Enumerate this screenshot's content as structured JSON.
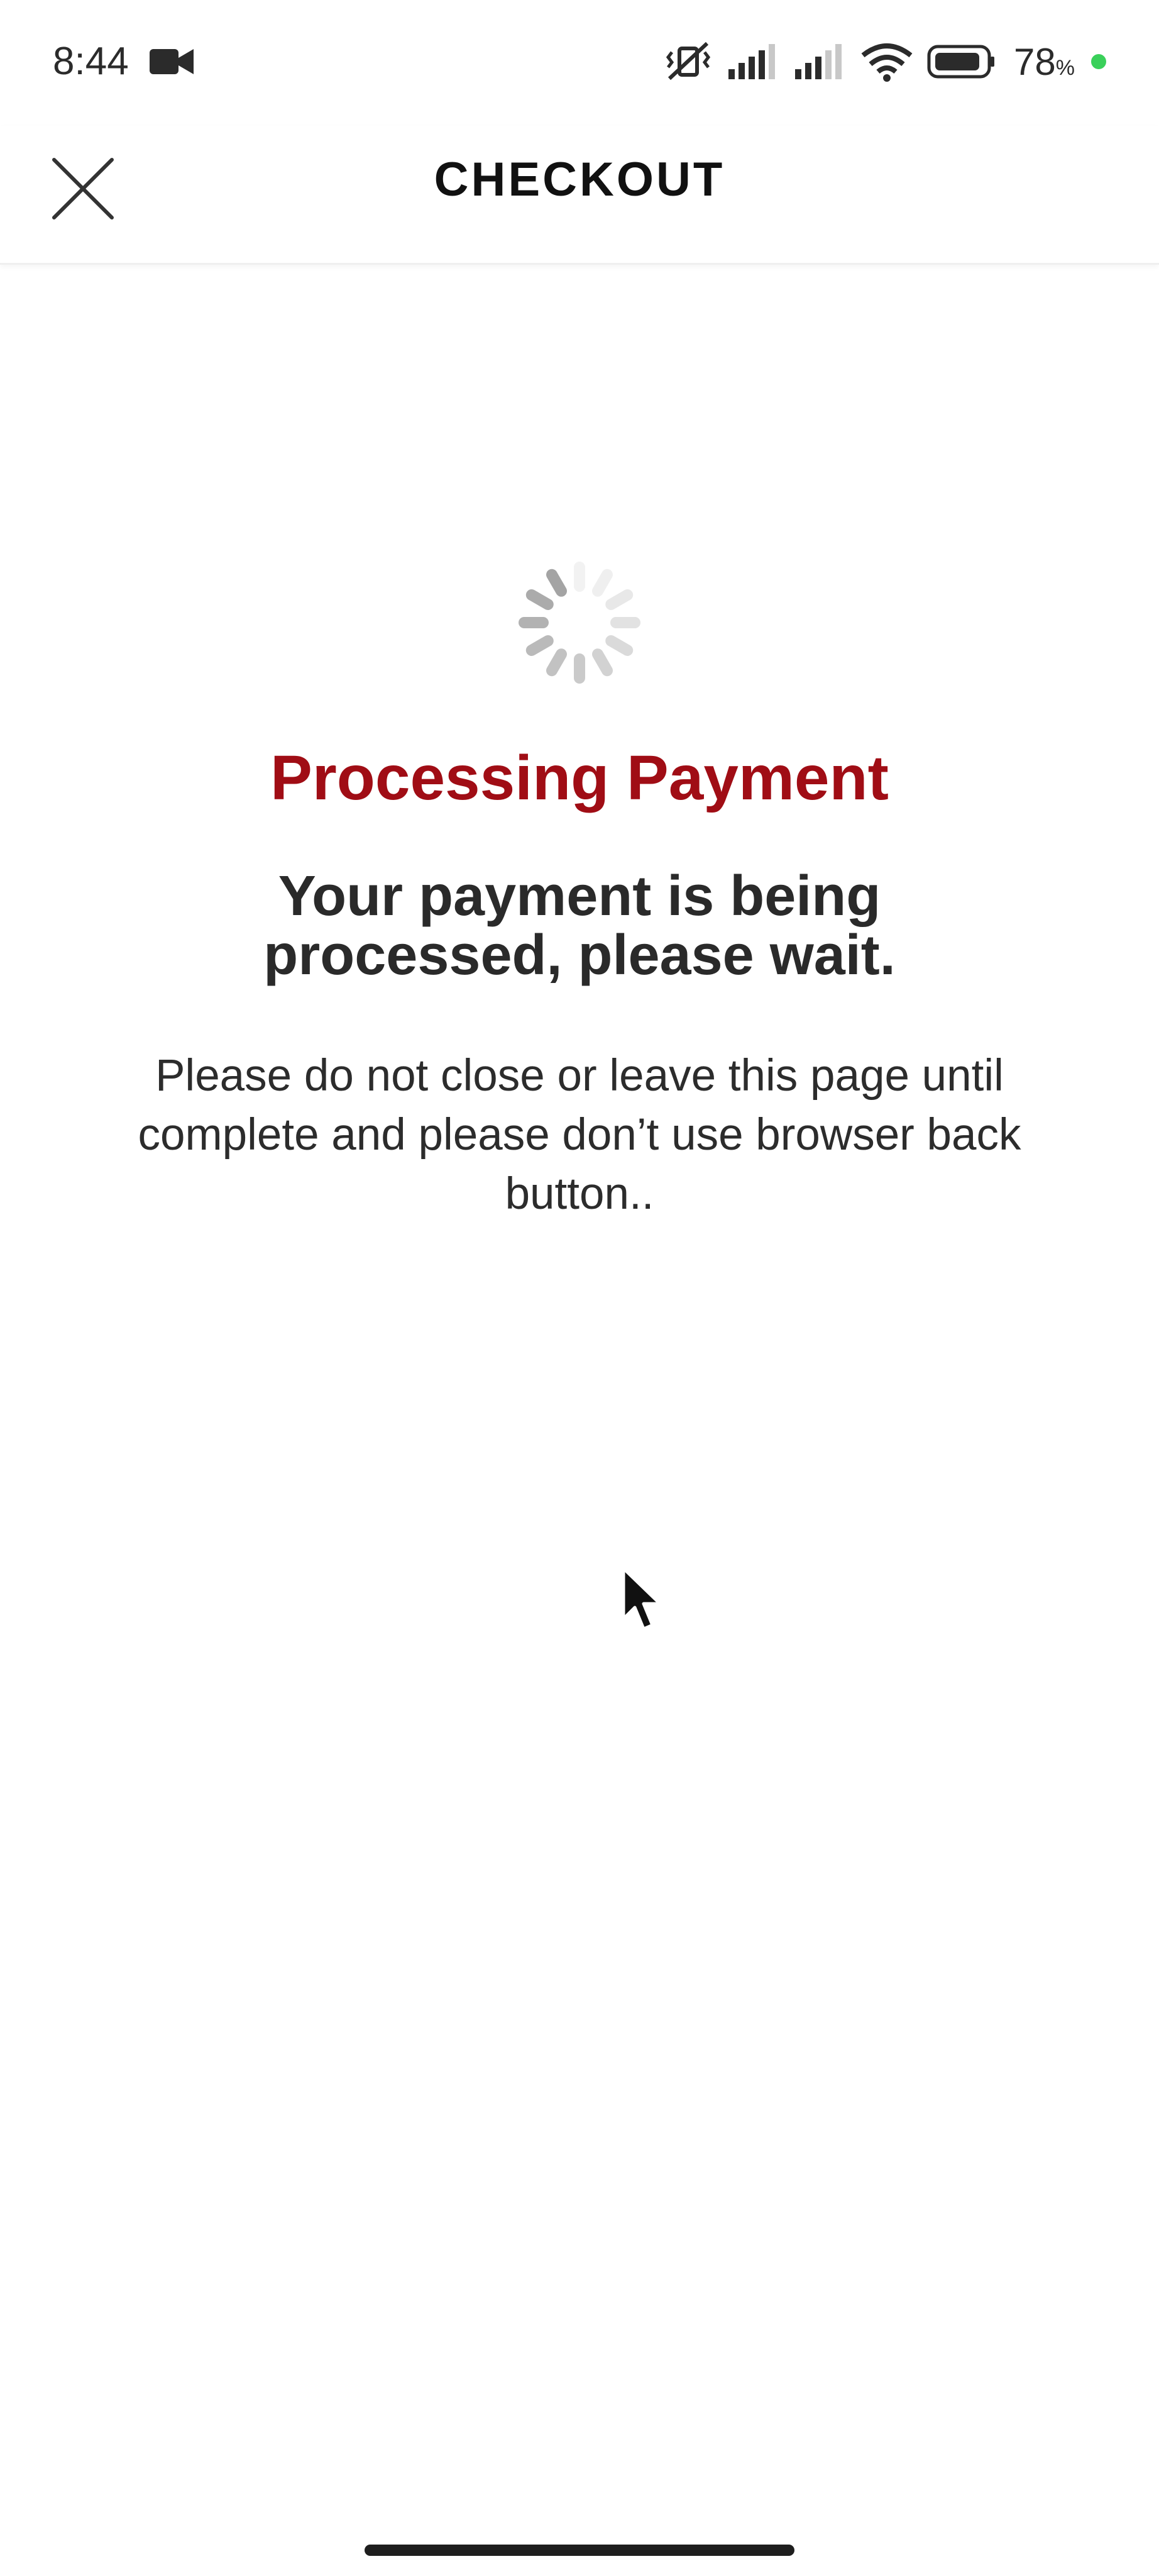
{
  "status_bar": {
    "time": "8:44",
    "battery_percent": "78",
    "battery_unit": "%",
    "icons": [
      "video-camera-icon",
      "vibrate-mute-icon",
      "signal-icon",
      "signal-icon",
      "wifi-icon",
      "battery-icon",
      "charging-dot-icon"
    ],
    "charge_color": "#3ad05a"
  },
  "header": {
    "title": "CHECKOUT",
    "close_icon": "close-icon"
  },
  "content": {
    "spinner_icon": "loading-spinner-icon",
    "processing_title": "Processing Payment",
    "subtitle": "Your payment is being processed, please wait.",
    "warning": "Please do not close or leave this page until complete and please don’t use browser back button..",
    "accent_color": "#a00d15"
  }
}
